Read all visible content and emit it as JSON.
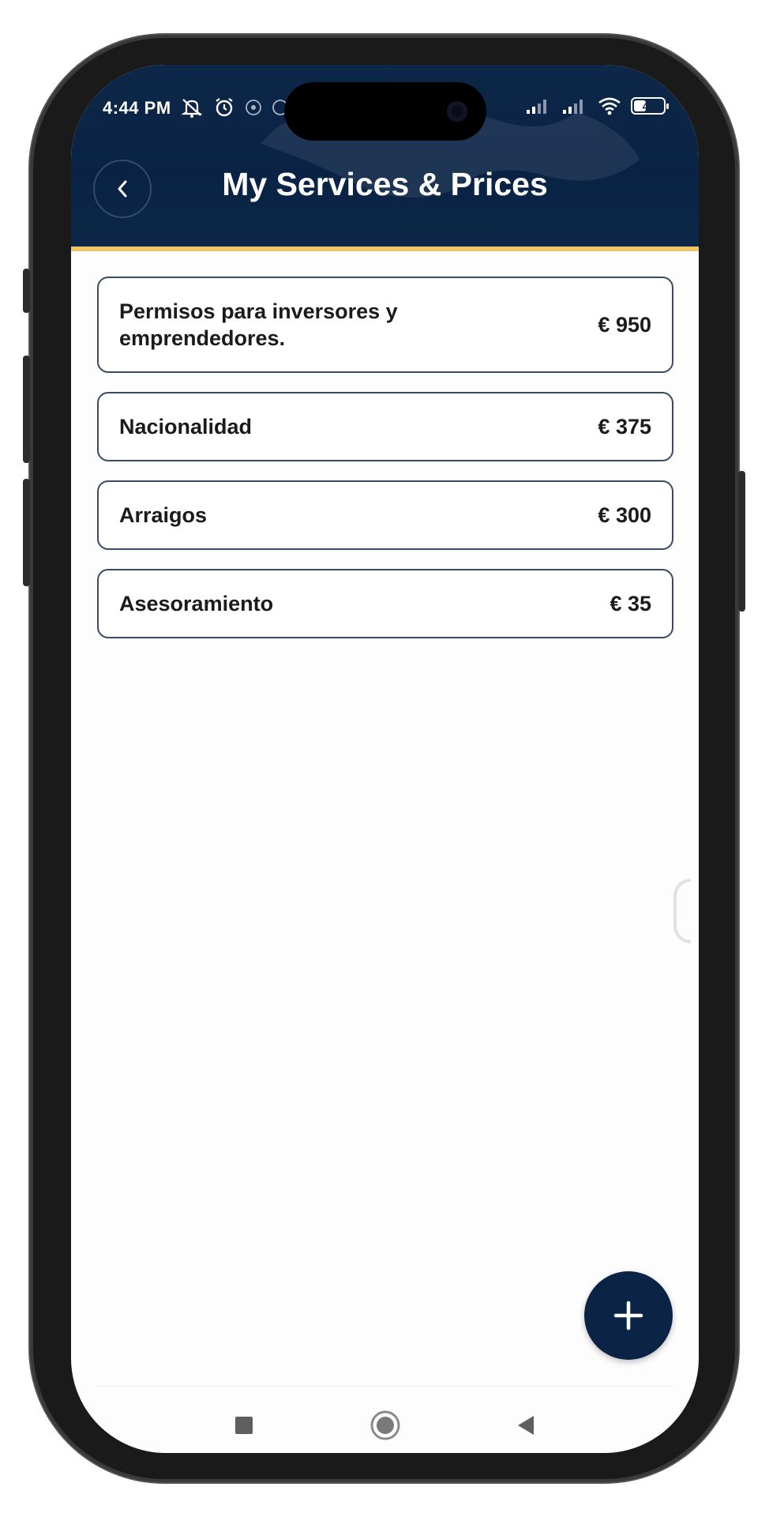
{
  "status_bar": {
    "time": "4:44 PM",
    "battery": "42",
    "battery_level": 0.42
  },
  "header": {
    "title": "My Services & Prices",
    "background_color": "#0b2446",
    "accent_color": "#f1c56a"
  },
  "services": [
    {
      "name": "Permisos para inversores y emprendedores.",
      "price": "€ 950"
    },
    {
      "name": "Nacionalidad",
      "price": "€ 375"
    },
    {
      "name": "Arraigos",
      "price": "€ 300"
    },
    {
      "name": "Asesoramiento",
      "price": "€ 35"
    }
  ],
  "icons": {
    "back": "chevron-left-icon",
    "add": "plus-icon",
    "nav_recents": "square-icon",
    "nav_home": "circle-icon",
    "nav_back": "triangle-left-icon"
  }
}
